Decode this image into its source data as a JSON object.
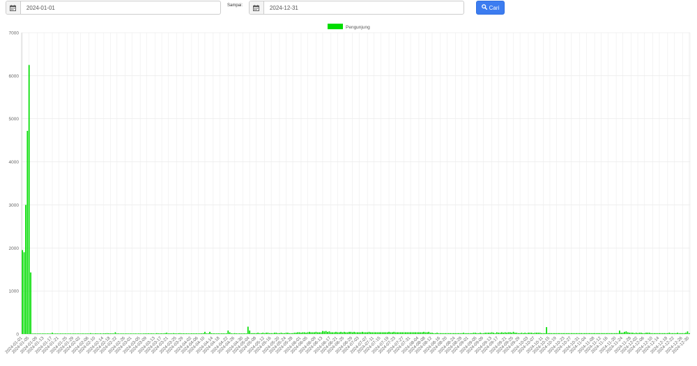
{
  "filter": {
    "from_date": "2024-01-01",
    "to_label": "Sampai:",
    "to_date": "2024-12-31",
    "search_label": "Cari",
    "icons": {
      "calendar": "calendar-icon",
      "search": "search-icon"
    },
    "button_color": "#3c7cf0"
  },
  "chart_data": {
    "type": "bar",
    "legend": {
      "label": "Pengunjung",
      "placement": "top-center",
      "color": "#00dd00"
    },
    "ylim": [
      0,
      7000
    ],
    "yticks": [
      0,
      1000,
      2000,
      3000,
      4000,
      5000,
      6000,
      7000
    ],
    "grid": true,
    "x_start": "2024-01-01",
    "x_end": "2024-12-30",
    "x_tick_labels": [
      "2024-01-01",
      "2024-01-05",
      "2024-01-09",
      "2024-01-13",
      "2024-01-17",
      "2024-01-21",
      "2024-01-25",
      "2024-01-29",
      "2024-02-02",
      "2024-02-06",
      "2024-02-10",
      "2024-02-14",
      "2024-02-18",
      "2024-02-22",
      "2024-02-26",
      "2024-03-01",
      "2024-03-05",
      "2024-03-09",
      "2024-03-13",
      "2024-03-17",
      "2024-03-21",
      "2024-03-25",
      "2024-03-29",
      "2024-04-02",
      "2024-04-06",
      "2024-04-10",
      "2024-04-14",
      "2024-04-18",
      "2024-04-22",
      "2024-04-26",
      "2024-04-30",
      "2024-05-04",
      "2024-05-08",
      "2024-05-12",
      "2024-05-16",
      "2024-05-20",
      "2024-05-24",
      "2024-05-28",
      "2024-06-01",
      "2024-06-05",
      "2024-06-09",
      "2024-06-13",
      "2024-06-17",
      "2024-06-21",
      "2024-06-25",
      "2024-06-29",
      "2024-07-03",
      "2024-07-07",
      "2024-07-11",
      "2024-07-15",
      "2024-07-19",
      "2024-07-23",
      "2024-07-27",
      "2024-07-31",
      "2024-08-04",
      "2024-08-08",
      "2024-08-12",
      "2024-08-16",
      "2024-08-20",
      "2024-08-24",
      "2024-08-28",
      "2024-09-01",
      "2024-09-05",
      "2024-09-09",
      "2024-09-13",
      "2024-09-17",
      "2024-09-21",
      "2024-09-25",
      "2024-09-29",
      "2024-10-03",
      "2024-10-07",
      "2024-10-11",
      "2024-10-15",
      "2024-10-19",
      "2024-10-23",
      "2024-10-27",
      "2024-10-31",
      "2024-11-04",
      "2024-11-08",
      "2024-11-12",
      "2024-11-16",
      "2024-11-20",
      "2024-11-24",
      "2024-11-28",
      "2024-12-02",
      "2024-12-06",
      "2024-12-10",
      "2024-12-14",
      "2024-12-18",
      "2024-12-22",
      "2024-12-26",
      "2024-12-30"
    ],
    "values": [
      1950,
      1900,
      3000,
      4720,
      6250,
      1430,
      10,
      10,
      10,
      10,
      10,
      10,
      10,
      10,
      10,
      10,
      10,
      10,
      30,
      10,
      10,
      10,
      10,
      10,
      10,
      10,
      10,
      10,
      10,
      10,
      10,
      10,
      10,
      10,
      10,
      10,
      10,
      10,
      10,
      10,
      10,
      20,
      10,
      10,
      15,
      15,
      10,
      15,
      10,
      15,
      15,
      20,
      15,
      15,
      15,
      10,
      40,
      10,
      10,
      10,
      10,
      10,
      10,
      10,
      10,
      10,
      10,
      10,
      10,
      10,
      10,
      10,
      10,
      10,
      15,
      15,
      15,
      15,
      15,
      10,
      10,
      20,
      15,
      15,
      15,
      15,
      20,
      30,
      15,
      15,
      15,
      20,
      15,
      15,
      15,
      20,
      15,
      15,
      15,
      15,
      10,
      15,
      15,
      15,
      15,
      15,
      15,
      15,
      15,
      20,
      50,
      15,
      15,
      50,
      20,
      15,
      15,
      15,
      15,
      15,
      15,
      15,
      15,
      15,
      80,
      40,
      15,
      15,
      20,
      15,
      15,
      15,
      15,
      15,
      15,
      15,
      170,
      80,
      20,
      20,
      20,
      20,
      30,
      20,
      20,
      30,
      20,
      30,
      30,
      20,
      20,
      20,
      30,
      30,
      20,
      20,
      30,
      20,
      20,
      30,
      30,
      20,
      20,
      20,
      30,
      30,
      40,
      40,
      30,
      40,
      40,
      30,
      40,
      50,
      40,
      40,
      40,
      50,
      40,
      40,
      40,
      70,
      60,
      70,
      50,
      60,
      40,
      40,
      40,
      50,
      40,
      40,
      50,
      40,
      50,
      40,
      40,
      50,
      50,
      40,
      50,
      40,
      40,
      40,
      40,
      50,
      40,
      40,
      40,
      50,
      40,
      40,
      40,
      40,
      40,
      40,
      40,
      40,
      40,
      40,
      40,
      50,
      40,
      40,
      50,
      40,
      40,
      40,
      40,
      40,
      40,
      40,
      40,
      40,
      40,
      40,
      40,
      40,
      40,
      40,
      40,
      40,
      50,
      40,
      40,
      50,
      30,
      30,
      20,
      20,
      30,
      20,
      20,
      20,
      20,
      20,
      20,
      20,
      20,
      20,
      20,
      20,
      20,
      20,
      20,
      20,
      30,
      20,
      20,
      20,
      20,
      20,
      30,
      30,
      20,
      20,
      30,
      20,
      20,
      30,
      30,
      30,
      30,
      40,
      30,
      20,
      40,
      30,
      30,
      40,
      30,
      40,
      30,
      40,
      40,
      30,
      50,
      30,
      30,
      20,
      20,
      30,
      20,
      30,
      20,
      30,
      30,
      30,
      20,
      30,
      30,
      30,
      30,
      20,
      20,
      20,
      160,
      20,
      20,
      20,
      20,
      20,
      20,
      20,
      20,
      20,
      20,
      20,
      20,
      20,
      20,
      20,
      20,
      20,
      20,
      20,
      20,
      20,
      20,
      20,
      20,
      20,
      20,
      20,
      20,
      20,
      20,
      20,
      20,
      20,
      20,
      20,
      20,
      20,
      20,
      20,
      20,
      20,
      20,
      20,
      80,
      30,
      30,
      50,
      60,
      40,
      30,
      30,
      30,
      20,
      30,
      20,
      30,
      30,
      20,
      20,
      30,
      30,
      30,
      20,
      20,
      20,
      20,
      20,
      20,
      20,
      20,
      20,
      20,
      20,
      30,
      20,
      20,
      20,
      20,
      30,
      20,
      20,
      20,
      20,
      30,
      60,
      20
    ]
  }
}
